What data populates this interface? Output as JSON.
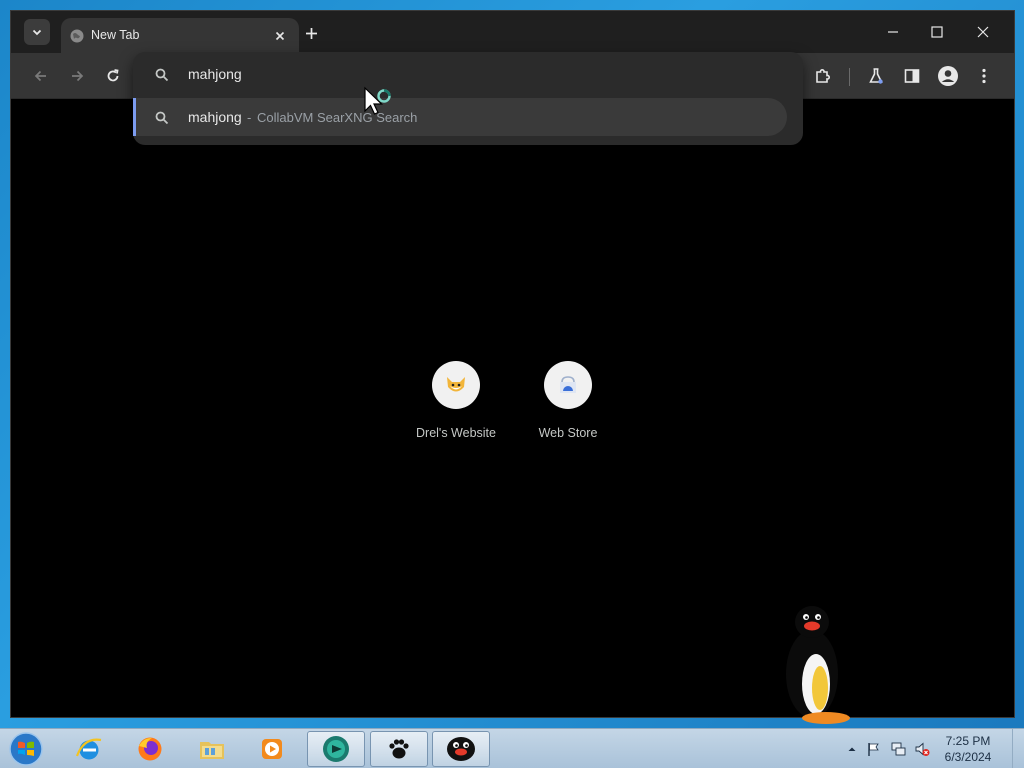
{
  "browser": {
    "tab": {
      "title": "New Tab",
      "favicon": "globe-icon"
    },
    "tab_search_icon": "chevron-down-icon",
    "new_tab_icon": "plus-icon",
    "window_controls": {
      "minimize": "minimize-icon",
      "maximize": "maximize-icon",
      "close": "close-icon"
    },
    "toolbar": {
      "back_icon": "arrow-left-icon",
      "forward_icon": "arrow-right-icon",
      "reload_icon": "reload-icon",
      "extensions_icon": "puzzle-icon",
      "labs_icon": "flask-icon",
      "side_panel_icon": "side-panel-icon",
      "profile_icon": "profile-icon",
      "menu_icon": "kebab-menu-icon"
    },
    "omnibox": {
      "query": "mahjong",
      "suggestion": {
        "query": "mahjong",
        "separator": "-",
        "engine": "CollabVM SearXNG Search"
      }
    },
    "shortcuts": [
      {
        "label": "Drel's Website",
        "icon": "fox-icon"
      },
      {
        "label": "Web Store",
        "icon": "web-store-icon"
      }
    ]
  },
  "taskbar": {
    "start": "windows-start-icon",
    "items": [
      {
        "name": "internet-explorer-icon",
        "active": false
      },
      {
        "name": "firefox-icon",
        "active": false
      },
      {
        "name": "file-explorer-icon",
        "active": false
      },
      {
        "name": "media-player-icon",
        "active": false
      },
      {
        "name": "chrome-icon",
        "active": true
      },
      {
        "name": "paw-icon",
        "active": true
      },
      {
        "name": "penguin-icon",
        "active": true
      }
    ],
    "tray": [
      "show-hidden-icons",
      "action-center-flag-icon",
      "network-icon",
      "volume-muted-icon"
    ],
    "clock": {
      "time": "7:25 PM",
      "date": "6/3/2024"
    }
  },
  "colors": {
    "accent_blue": "#7c9cf0",
    "tab_active": "#353535",
    "window_bg": "#1f1f1f",
    "content_bg": "#000000"
  }
}
